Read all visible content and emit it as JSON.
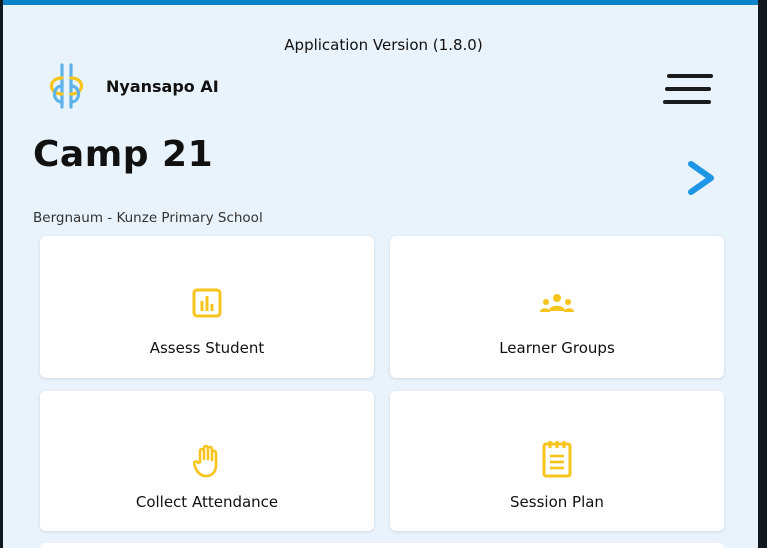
{
  "header": {
    "version": "Application Version (1.8.0)",
    "app_name": "Nyansapo AI",
    "logo_icon": "nyansapo-logo-icon",
    "menu_icon": "hamburger-menu-icon"
  },
  "camp": {
    "title": "Camp 21",
    "school": "Bergnaum - Kunze Primary School",
    "next_icon": "chevron-right-icon"
  },
  "cards": [
    {
      "label": "Assess Student",
      "icon": "bar-chart-icon"
    },
    {
      "label": "Learner Groups",
      "icon": "people-group-icon"
    },
    {
      "label": "Collect Attendance",
      "icon": "raised-hand-icon"
    },
    {
      "label": "Session Plan",
      "icon": "notepad-icon"
    }
  ],
  "colors": {
    "accent": "#0c82c9",
    "icon_yellow": "#f6c41a",
    "arrow_blue": "#1e96e6",
    "background": "#e9f3fb"
  }
}
